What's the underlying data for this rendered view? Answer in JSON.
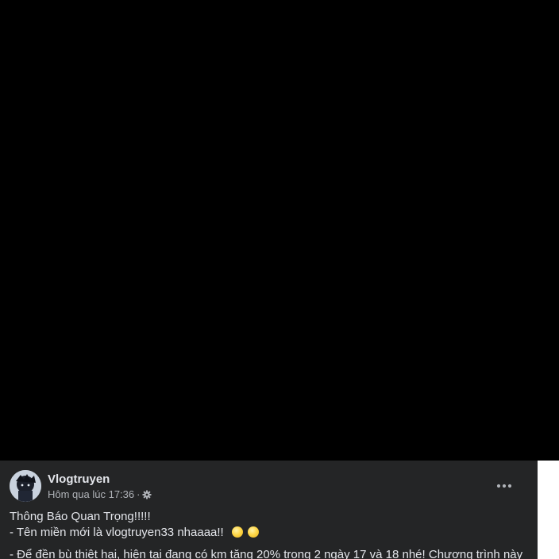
{
  "post": {
    "author": "Vlogtruyen",
    "timestamp": "Hôm qua lúc 17:36",
    "separator": "·",
    "privacy_icon": "gear-icon",
    "more_icon": "more-horizontal-icon",
    "lines": [
      "Thông Báo Quan Trọng!!!!!",
      "- Tên miền mới là vlogtruyen33 nhaaaa!!",
      "- Để đền bù thiệt hại, hiện tại đang có km tăng 20% trong 2 ngày 17 và 18 nhé! Chương trình này"
    ],
    "emojis": [
      "yellow-face-emoji",
      "yellow-face-emoji"
    ]
  }
}
